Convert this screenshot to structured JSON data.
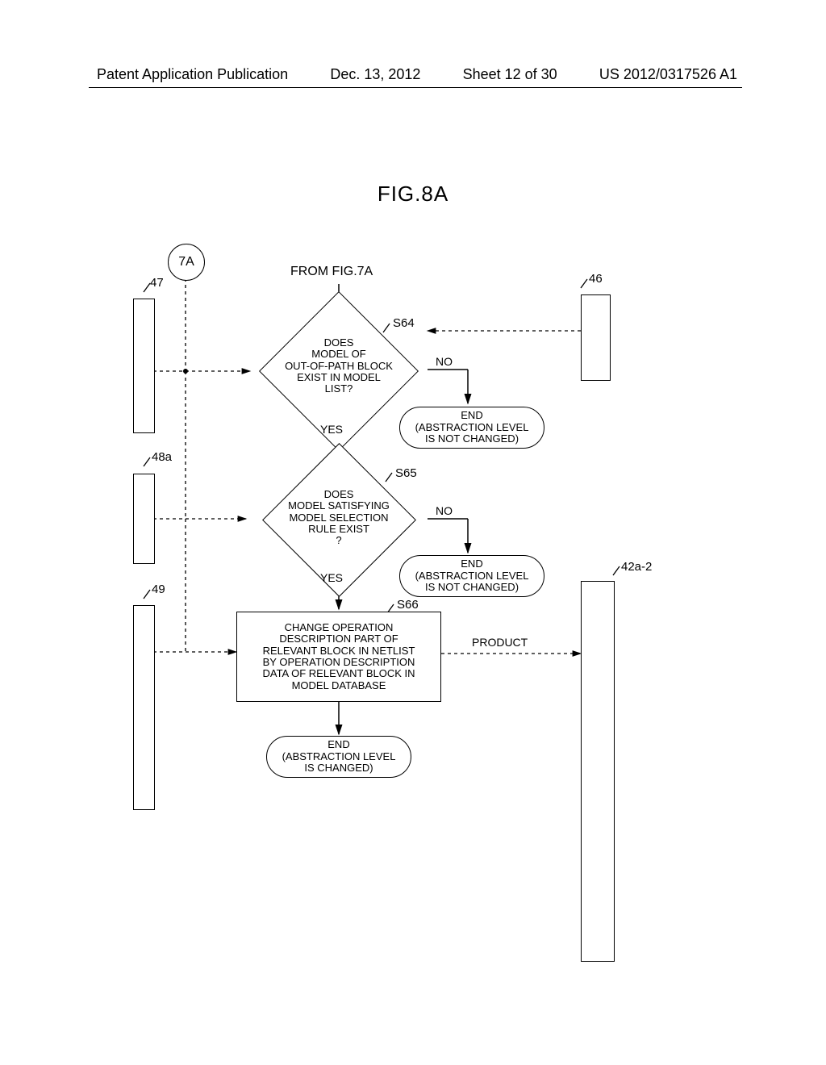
{
  "header": {
    "left": "Patent Application Publication",
    "date": "Dec. 13, 2012",
    "sheet": "Sheet 12 of 30",
    "pubno": "US 2012/0317526 A1"
  },
  "figure": {
    "title": "FIG.8A",
    "from": "FROM FIG.7A",
    "connector": "7A"
  },
  "refs": {
    "r47": "47",
    "r48a": "48a",
    "r49": "49",
    "r46": "46",
    "r42a2": "42a-2"
  },
  "steps": {
    "s64": "S64",
    "s65": "S65",
    "s66": "S66"
  },
  "nodes": {
    "d64": "DOES\nMODEL OF\nOUT-OF-PATH BLOCK\nEXIST IN MODEL\nLIST?",
    "d65": "DOES\nMODEL SATISFYING\nMODEL SELECTION\nRULE EXIST\n?",
    "p66": "CHANGE OPERATION\nDESCRIPTION PART OF\nRELEVANT BLOCK IN NETLIST\nBY OPERATION DESCRIPTION\nDATA OF RELEVANT BLOCK IN\nMODEL DATABASE",
    "end_no1": "END\n(ABSTRACTION LEVEL\nIS NOT CHANGED)",
    "end_no2": "END\n(ABSTRACTION LEVEL\nIS NOT CHANGED)",
    "end_yes": "END\n(ABSTRACTION LEVEL\nIS CHANGED)"
  },
  "branches": {
    "yes": "YES",
    "no": "NO",
    "product": "PRODUCT"
  }
}
